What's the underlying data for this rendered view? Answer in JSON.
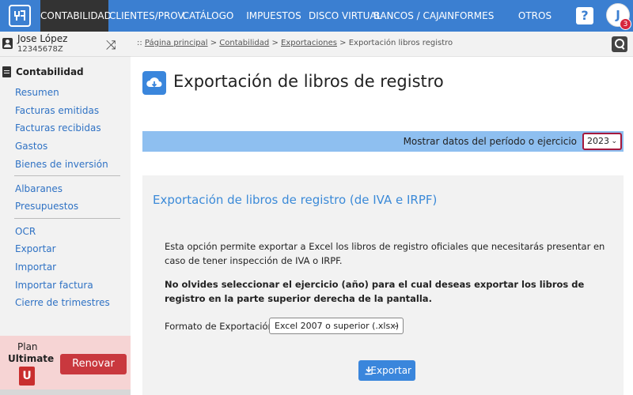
{
  "nav": {
    "items": [
      {
        "label": "CONTABILIDAD",
        "active": true
      },
      {
        "label": "CLIENTES/PROV."
      },
      {
        "label": "CATÁLOGO"
      },
      {
        "label": "IMPUESTOS"
      },
      {
        "label": "DISCO VIRTUAL"
      },
      {
        "label": "BANCOS / CAJA"
      },
      {
        "label": "INFORMES"
      },
      {
        "label": "OTROS"
      }
    ],
    "help_label": "?",
    "avatar_initial": "J",
    "notification_count": "3"
  },
  "user": {
    "name": "Jose López",
    "id": "12345678Z"
  },
  "sidebar": {
    "section_title": "Contabilidad",
    "group1": [
      "Resumen",
      "Facturas emitidas",
      "Facturas recibidas",
      "Gastos",
      "Bienes de inversión"
    ],
    "group2": [
      "Albaranes",
      "Presupuestos"
    ],
    "group3": [
      "OCR",
      "Exportar",
      "Importar",
      "Importar factura",
      "Cierre de trimestres"
    ],
    "plan": {
      "label": "Plan",
      "name": "Ultimate",
      "icon_letter": "U",
      "renew_label": "Renovar"
    }
  },
  "breadcrumb": {
    "prefix": ":: ",
    "items": [
      "Página principal",
      "Contabilidad",
      "Exportaciones"
    ],
    "separator": " > ",
    "current": "Exportación libros registro"
  },
  "page": {
    "title": "Exportación de libros de registro",
    "period_label": "Mostrar datos del período o ejercicio",
    "year_value": "2023"
  },
  "panel": {
    "title": "Exportación de libros de registro (de IVA e IRPF)",
    "description": "Esta opción permite exportar a Excel los libros de registro oficiales que necesitarás presentar en caso de tener inspección de IVA o IRPF.",
    "note": "No olvides seleccionar el ejercicio (año) para el cual deseas exportar los libros de registro en la parte superior derecha de la pantalla.",
    "format_label": "Formato de Exportación:",
    "format_value": "Excel 2007 o superior (.xlsx)",
    "export_label": "Exportar"
  },
  "colors": {
    "nav_bg": "#3b7fd1",
    "nav_active": "#333333",
    "link": "#2f72c4",
    "accent": "#3a86dc",
    "period_bar": "#8ebff0",
    "renew": "#c9383e",
    "plan_bg": "#f6d4d4"
  }
}
